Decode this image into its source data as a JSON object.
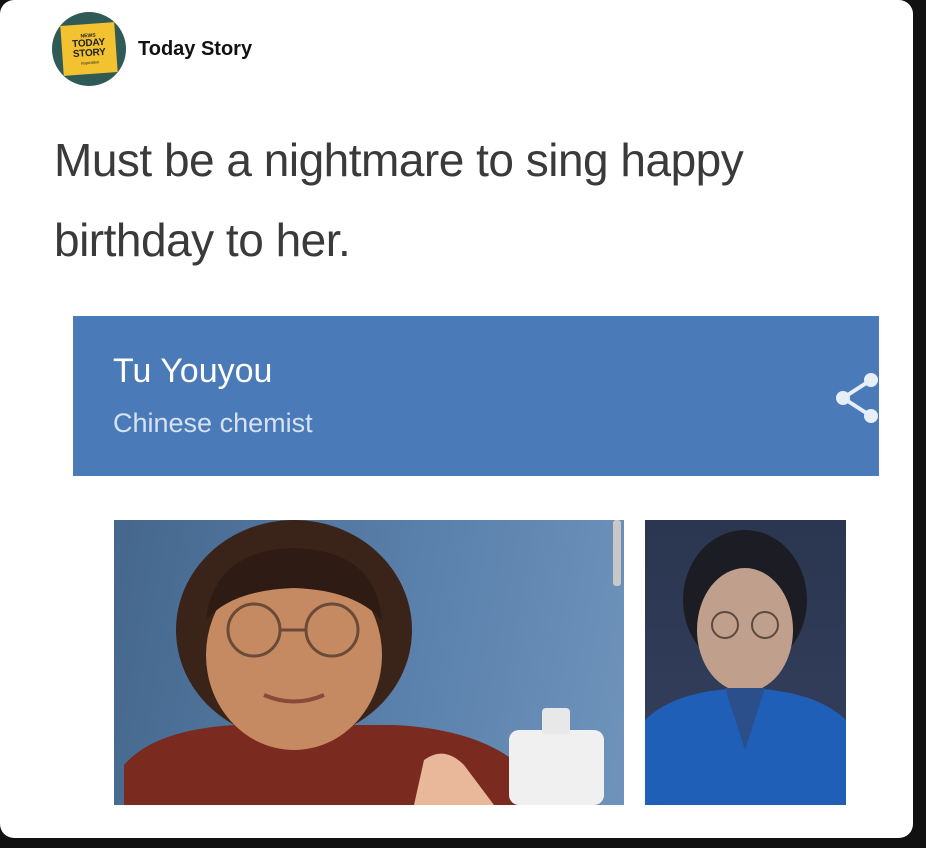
{
  "post": {
    "account_name": "Today Story",
    "avatar": {
      "icon": "today-story-logo",
      "lines": [
        "NEWS",
        "TODAY",
        "STORY",
        "Inspiration"
      ]
    },
    "caption": "Must be a nightmare to sing happy birthday to her."
  },
  "knowledge_panel": {
    "title": "Tu Youyou",
    "subtitle": "Chinese chemist",
    "share_icon": "share-icon",
    "accent_color": "#4a7ab8",
    "photos": [
      {
        "icon": "portrait-photo"
      },
      {
        "icon": "portrait-photo"
      }
    ]
  }
}
